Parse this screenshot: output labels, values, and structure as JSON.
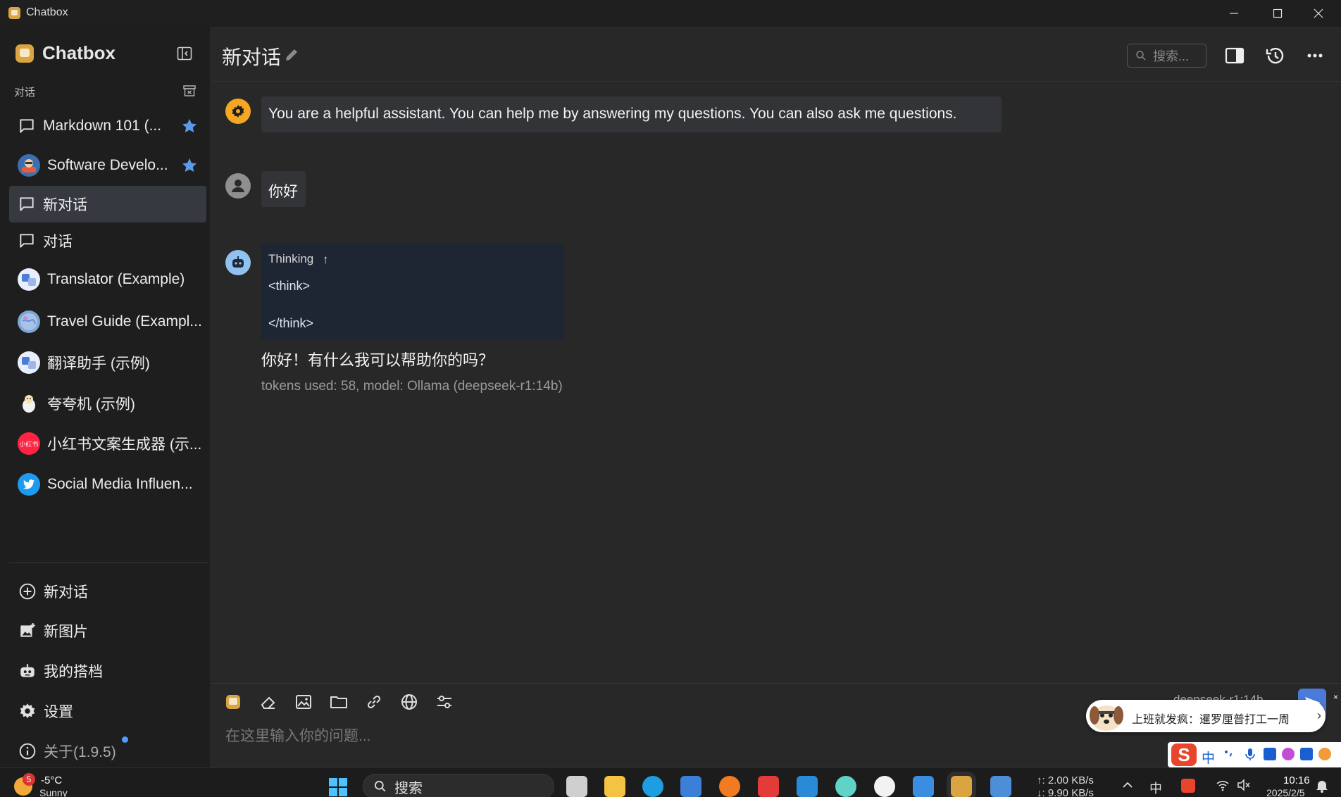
{
  "window": {
    "title": "Chatbox",
    "controls": [
      "minimize-icon",
      "maximize-icon",
      "close-icon"
    ]
  },
  "sidebar": {
    "brand": "Chatbox",
    "section_label": "对话",
    "conversations": [
      {
        "label": "Markdown 101 (...",
        "icon": "chat-bubble-icon",
        "starred": true
      },
      {
        "label": "Software Develo...",
        "icon": "developer-avatar",
        "starred": true
      },
      {
        "label": "新对话",
        "icon": "chat-bubble-icon",
        "active": true
      },
      {
        "label": "对话",
        "icon": "chat-bubble-icon"
      },
      {
        "label": "Translator (Example)",
        "icon": "translator-avatar"
      },
      {
        "label": "Travel Guide (Exampl...",
        "icon": "travel-avatar"
      },
      {
        "label": "翻译助手 (示例)",
        "icon": "translator-avatar"
      },
      {
        "label": "夸夸机 (示例)",
        "icon": "praise-avatar"
      },
      {
        "label": "小红书文案生成器 (示...",
        "icon": "xiaohongshu-avatar"
      },
      {
        "label": "Social Media Influen...",
        "icon": "twitter-avatar"
      }
    ],
    "xhs_avatar_text": "小红书",
    "footer": {
      "new_chat": "新对话",
      "new_image": "新图片",
      "my_copilots": "我的搭档",
      "settings": "设置",
      "about": "关于(1.9.5)"
    }
  },
  "header": {
    "title": "新对话",
    "search_placeholder": "搜索..."
  },
  "messages": {
    "system": "You are a helpful assistant. You can help me by answering my questions. You can also ask me questions.",
    "user": "你好",
    "thinking_label": "Thinking",
    "thinking_arrow": "↑",
    "think_open": "<think>",
    "think_close": "</think>",
    "assistant": "你好！有什么我可以帮助你的吗？",
    "token_info": "tokens used: 58, model: Ollama (deepseek-r1:14b)"
  },
  "composer": {
    "placeholder": "在这里输入你的问题...",
    "model_selector": "deepseek-r1:14b"
  },
  "notification": {
    "text": "上班就发疯：暹罗厘普打工一周",
    "chevron": "›",
    "close": "×"
  },
  "ime": {
    "logo": "S",
    "mode": "中"
  },
  "taskbar": {
    "weather_badge": "5",
    "temperature": "-5°C",
    "weather": "Sunny",
    "search": "搜索",
    "net_up": "↑: 2.00 KB/s",
    "net_down": "↓: 9.90 KB/s",
    "ime_mode": "中",
    "time": "10:16",
    "date": "2025/2/5"
  },
  "colors": {
    "accent_star": "#5b9bea",
    "send_button": "#4a7bd8",
    "thinking_bg": "#1e2634",
    "brand": "#d9a441"
  }
}
